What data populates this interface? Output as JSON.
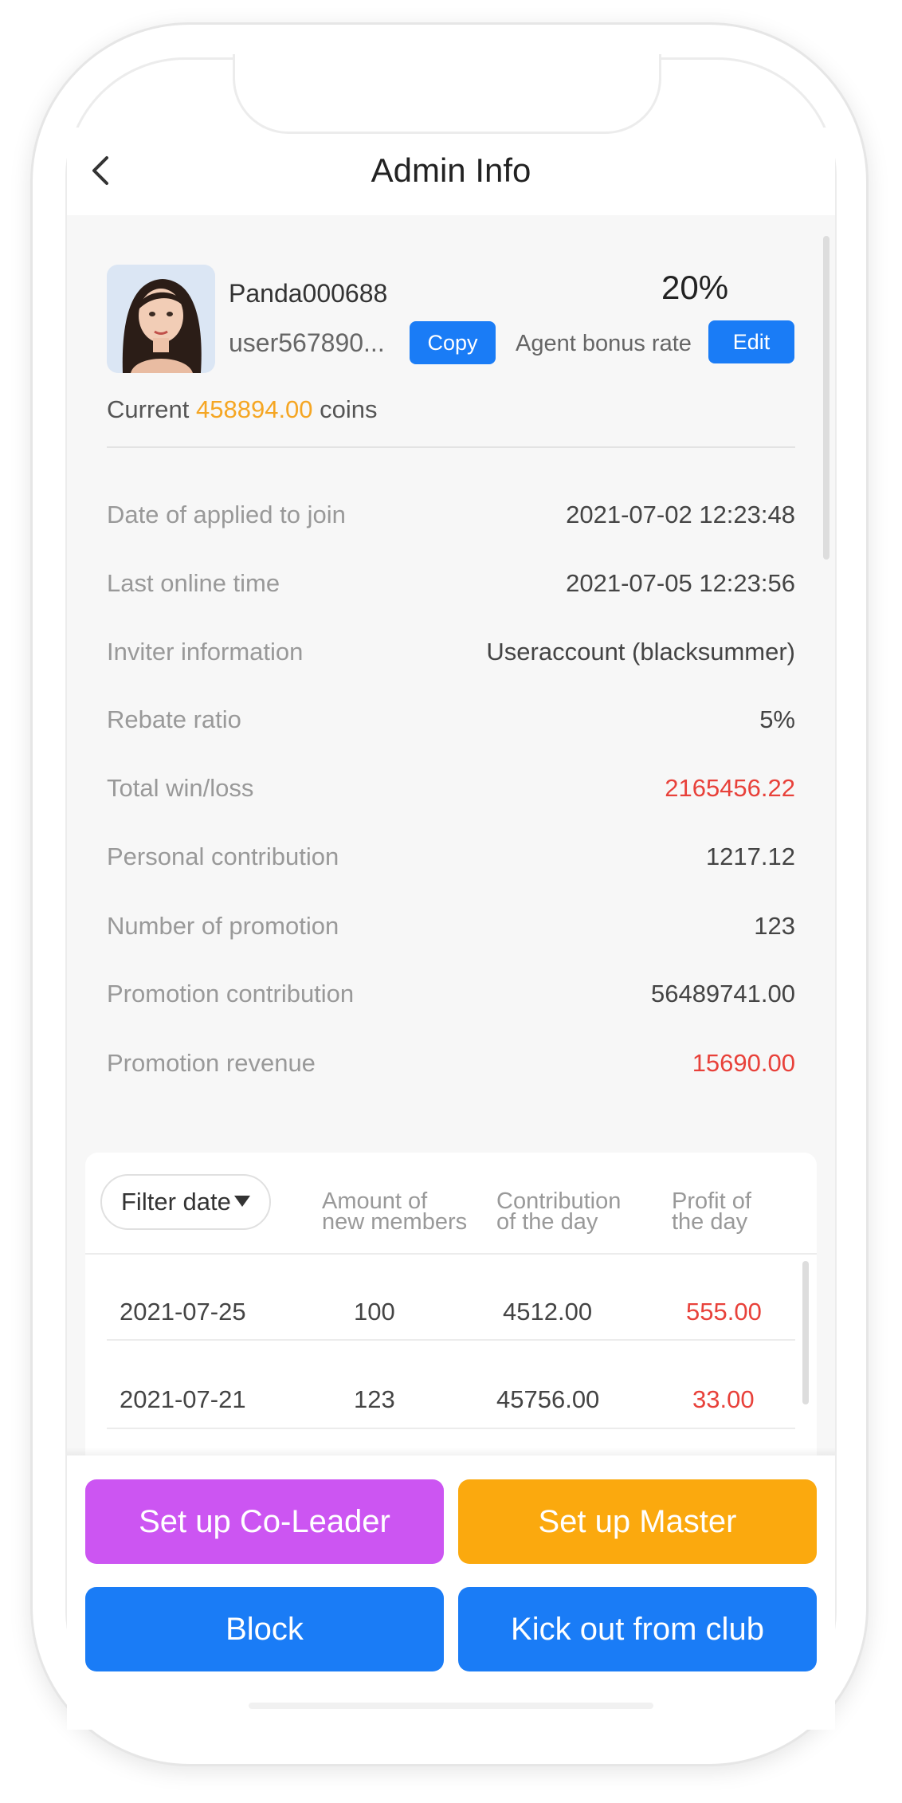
{
  "header": {
    "title": "Admin Info"
  },
  "profile": {
    "username": "Panda000688",
    "user_id": "user567890...",
    "copy_label": "Copy",
    "bonus_rate": "20%",
    "bonus_label": "Agent bonus rate",
    "edit_label": "Edit",
    "current_prefix": "Current",
    "coins_value": "458894.00",
    "coins_suffix": "coins"
  },
  "info": [
    {
      "label": "Date of applied to join",
      "value": "2021-07-02 12:23:48"
    },
    {
      "label": "Last online time",
      "value": "2021-07-05 12:23:56"
    },
    {
      "label": "Inviter information",
      "value": "Useraccount (blacksummer)"
    },
    {
      "label": "Rebate ratio",
      "value": "5%"
    },
    {
      "label": "Total win/loss",
      "value": "2165456.22"
    },
    {
      "label": "Personal contribution",
      "value": "1217.12"
    },
    {
      "label": "Number of promotion",
      "value": "123"
    },
    {
      "label": "Promotion contribution",
      "value": "56489741.00"
    },
    {
      "label": "Promotion revenue",
      "value": "15690.00"
    }
  ],
  "table": {
    "filter_label": "Filter date",
    "headers": [
      {
        "line1": "Amount of",
        "line2": "new members"
      },
      {
        "line1": "Contribution",
        "line2": "of the day"
      },
      {
        "line1": "Profit of",
        "line2": "the day"
      }
    ],
    "rows": [
      {
        "date": "2021-07-25",
        "members": "100",
        "contribution": "4512.00",
        "profit": "555.00"
      },
      {
        "date": "2021-07-21",
        "members": "123",
        "contribution": "45756.00",
        "profit": "33.00"
      }
    ]
  },
  "actions": {
    "co_leader": "Set up Co-Leader",
    "master": "Set up Master",
    "block": "Block",
    "kick": "Kick out from club"
  },
  "colors": {
    "primary_blue": "#1a7cf6",
    "purple": "#cc55f2",
    "orange": "#fba90e",
    "coins": "#f5a623",
    "negative_red": "#e8413a"
  }
}
